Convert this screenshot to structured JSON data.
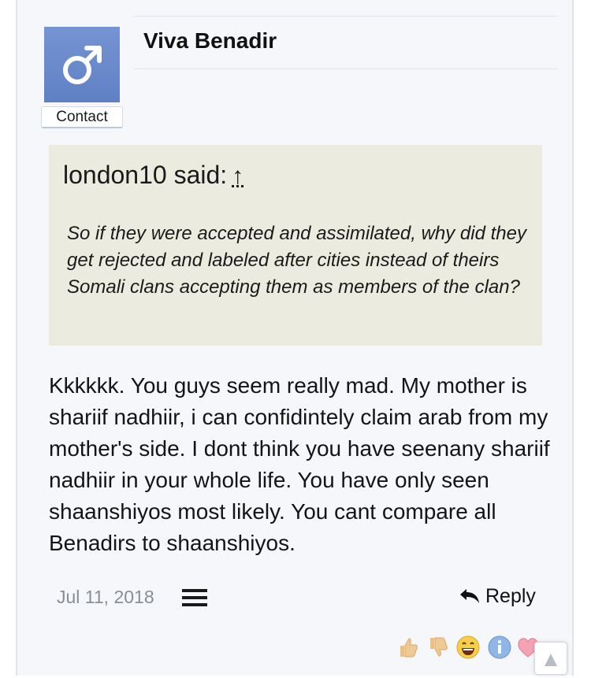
{
  "post": {
    "username": "Viva Benadir",
    "avatar_icon": "male-symbol-icon",
    "avatar_color": "#6a8acb",
    "contact_label": "Contact",
    "quote": {
      "author_said": "london10 said:",
      "jump_icon": "↑",
      "text": "So if they were accepted and assimilated, why did they get rejected and labeled after cities instead of theirs Somali clans accepting them as members of the clan?"
    },
    "body": "Kkkkkk. You guys seem really mad. My mother is shariif nadhiir, i can confidintely claim arab from my mother's side. I dont think you have seenany shariif nadhiir in your whole life. You have only seen shaanshiyos most likely. You cant compare all Benadirs to shaanshiyos.",
    "date": "Jul 11, 2018",
    "reply_label": "Reply",
    "reactions": [
      "like-icon",
      "dislike-icon",
      "laugh-icon",
      "info-icon",
      "love-icon"
    ]
  }
}
